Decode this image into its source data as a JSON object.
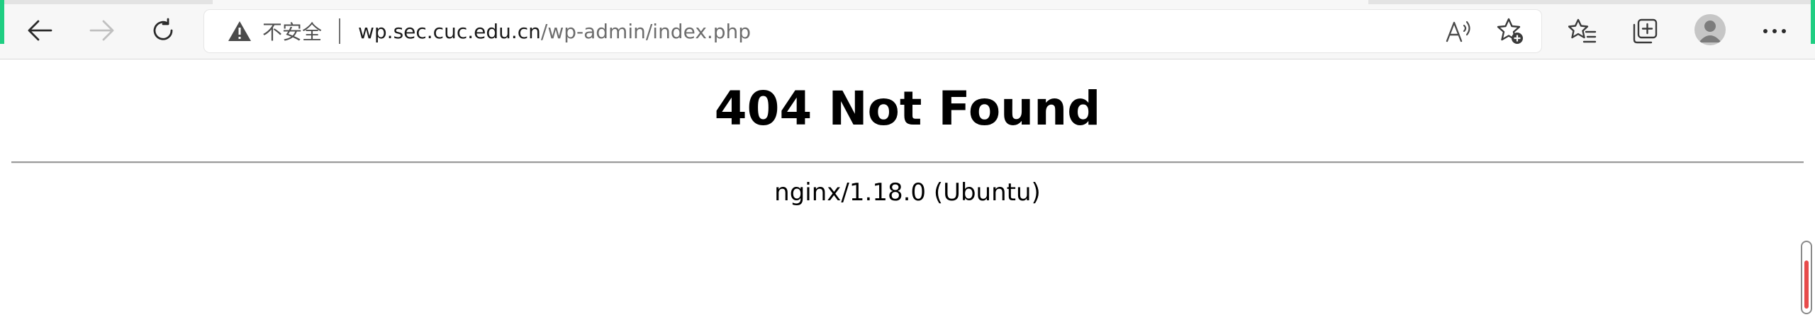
{
  "browser": {
    "security_label": "不安全",
    "url_host": "wp.sec.cuc.edu.cn",
    "url_path": "/wp-admin/index.php",
    "icons": {
      "back": "arrow-left-icon",
      "forward": "arrow-right-icon",
      "refresh": "refresh-icon",
      "warning": "warning-triangle-icon",
      "read_aloud": "read-aloud-icon",
      "add_favorite": "star-plus-icon",
      "favorites": "favorites-list-icon",
      "collections": "collections-icon",
      "profile": "profile-avatar-icon",
      "more": "more-dots-icon"
    },
    "colors": {
      "accent": "#1fce82",
      "toolbar_bg": "#f7f7f7"
    }
  },
  "page": {
    "heading": "404 Not Found",
    "server_signature": "nginx/1.18.0 (Ubuntu)"
  }
}
